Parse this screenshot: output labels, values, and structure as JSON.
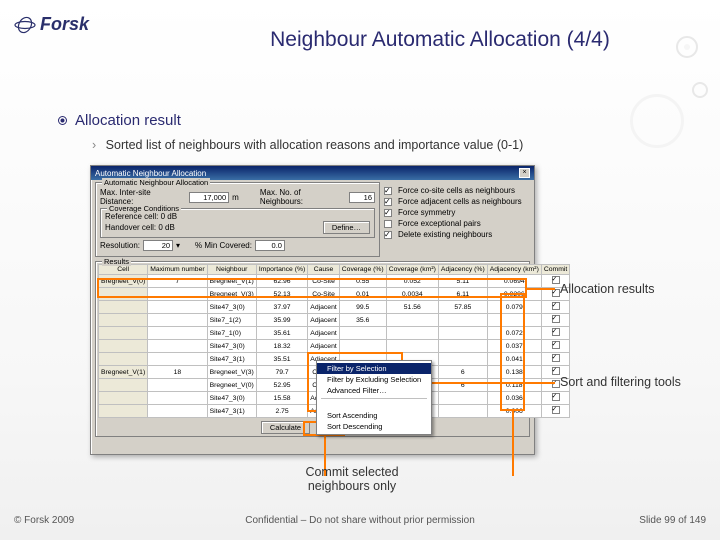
{
  "logo_text": "Forsk",
  "title": "Neighbour Automatic Allocation (4/4)",
  "bullet_main": "Allocation result",
  "bullet_sub": "Sorted list of neighbours with allocation reasons and importance value (0-1)",
  "win": {
    "title": "Automatic Neighbour Allocation",
    "gb_alloc": "Automatic Neighbour Allocation",
    "max_dist_label": "Max. Inter-site Distance:",
    "max_dist_value": "17,000",
    "max_dist_unit": "m",
    "max_nb_label": "Max. No. of Neighbours:",
    "max_nb_value": "16",
    "gb_cov": "Coverage Conditions",
    "cov_line1": "Reference cell: 0 dB",
    "cov_line2": "Handover cell: 0 dB",
    "define_btn": "Define…",
    "resolution_label": "Resolution:",
    "resolution_value": "20",
    "min_cov_label": "% Min Covered:",
    "min_cov_value": "0.0",
    "chk_force_co": "Force co-site cells as neighbours",
    "chk_force_adj": "Force adjacent cells as neighbours",
    "chk_symmetry": "Force symmetry",
    "chk_exceptional": "Force exceptional pairs",
    "chk_delete": "Delete existing neighbours",
    "gb_results": "Results",
    "headers": [
      "Cell",
      "Maximum number",
      "Neighbour",
      "Importance (%)",
      "Cause",
      "Coverage (%)",
      "Coverage (km²)",
      "Adjacency (%)",
      "Adjacency (km²)",
      "Commit"
    ],
    "rows": [
      {
        "cell": "Bregneet_V(0)",
        "max": "7",
        "neigh": "Bregneet_V(1)",
        "imp": "62.96",
        "cause": "Co-Site",
        "cov": "0.55",
        "covk": "0.052",
        "adj": "5.11",
        "adjk": "0.0694",
        "commit": true
      },
      {
        "cell": "",
        "max": "",
        "neigh": "Bregneet_V(3)",
        "imp": "52.13",
        "cause": "Co-Site",
        "cov": "0.01",
        "covk": "0.0034",
        "adj": "6.11",
        "adjk": "0.0206",
        "commit": true
      },
      {
        "cell": "",
        "max": "",
        "neigh": "Site47_3(0)",
        "imp": "37.97",
        "cause": "Adjacent",
        "cov": "99.5",
        "covk": "51.56",
        "adj": "57.85",
        "adjk": "0.079",
        "commit": true
      },
      {
        "cell": "",
        "max": "",
        "neigh": "Site7_1(2)",
        "imp": "35.99",
        "cause": "Adjacent",
        "cov": "35.6",
        "covk": "",
        "adj": "",
        "adjk": "",
        "commit": true
      },
      {
        "cell": "",
        "max": "",
        "neigh": "Site7_1(0)",
        "imp": "35.61",
        "cause": "Adjacent",
        "cov": "",
        "covk": "",
        "adj": "",
        "adjk": "0.072",
        "commit": true
      },
      {
        "cell": "",
        "max": "",
        "neigh": "Site47_3(0)",
        "imp": "18.32",
        "cause": "Adjacent",
        "cov": "",
        "covk": "",
        "adj": "",
        "adjk": "0.037",
        "commit": true
      },
      {
        "cell": "",
        "max": "",
        "neigh": "Site47_3(1)",
        "imp": "35.51",
        "cause": "Adjacent",
        "cov": "",
        "covk": "",
        "adj": "",
        "adjk": "0.041",
        "commit": true
      },
      {
        "cell": "Bregneet_V(1)",
        "max": "18",
        "neigh": "Bregneet_V(3)",
        "imp": "79.7",
        "cause": "Co-Site",
        "cov": "",
        "covk": "",
        "adj": "6",
        "adjk": "0.138",
        "commit": true
      },
      {
        "cell": "",
        "max": "",
        "neigh": "Bregneet_V(0)",
        "imp": "52.95",
        "cause": "Co-Site",
        "cov": "",
        "covk": "",
        "adj": "6",
        "adjk": "0.118",
        "commit": true
      },
      {
        "cell": "",
        "max": "",
        "neigh": "Site47_3(0)",
        "imp": "15.58",
        "cause": "Adjacent",
        "cov": "",
        "covk": "",
        "adj": "",
        "adjk": "0.036",
        "commit": true
      },
      {
        "cell": "",
        "max": "",
        "neigh": "Site47_3(1)",
        "imp": "2.75",
        "cause": "Adjacent",
        "cov": "",
        "covk": "",
        "adj": "",
        "adjk": "0.006",
        "commit": true
      }
    ],
    "menu": {
      "items": [
        "Filter by Selection",
        "Filter by Excluding Selection",
        "Advanced Filter…",
        "",
        "Sort Ascending",
        "Sort Descending"
      ],
      "highlighted": "Filter by Selection"
    },
    "btn_calculate": "Calculate",
    "btn_commit": "Commit"
  },
  "annot_results": "Allocation results",
  "annot_sort": "Sort and filtering tools",
  "annot_commit": "Commit selected neighbours only",
  "footer_left": "© Forsk 2009",
  "footer_center": "Confidential – Do not share without prior permission",
  "footer_right": "Slide 99 of 149"
}
